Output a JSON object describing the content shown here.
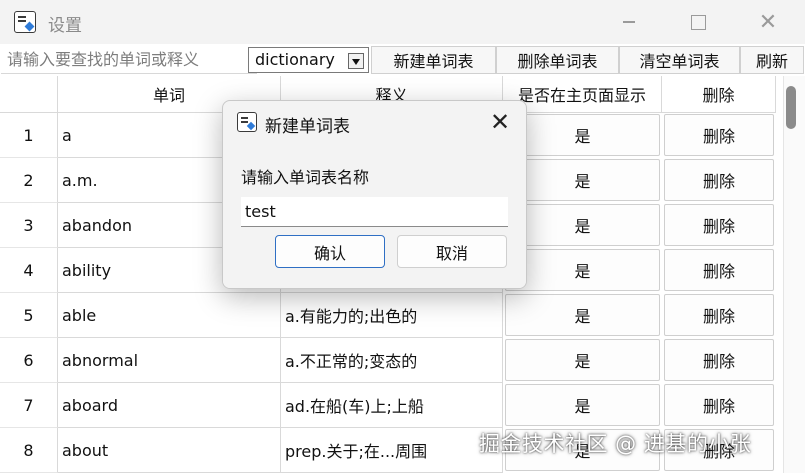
{
  "window": {
    "title": "设置",
    "icon": "notepad-icon",
    "controls": [
      "minimize-icon",
      "maximize-icon",
      "close-icon"
    ]
  },
  "toolbar": {
    "search_placeholder": "请输入要查找的单词或释义",
    "dictionary_selected": "dictionary",
    "new_table_label": "新建单词表",
    "delete_table_label": "删除单词表",
    "clear_table_label": "清空单词表",
    "refresh_label": "刷新"
  },
  "table": {
    "headers": [
      "单词",
      "释义",
      "是否在主页面显示",
      "删除"
    ],
    "rows": [
      {
        "num": "1",
        "word": "a",
        "meaning": "",
        "show": "是",
        "delete": "删除"
      },
      {
        "num": "2",
        "word": "a.m.",
        "meaning": "",
        "show": "是",
        "delete": "删除"
      },
      {
        "num": "3",
        "word": "abandon",
        "meaning": "",
        "show": "是",
        "delete": "删除"
      },
      {
        "num": "4",
        "word": "ability",
        "meaning": "",
        "show": "是",
        "delete": "删除"
      },
      {
        "num": "5",
        "word": "able",
        "meaning": "a.有能力的;出色的",
        "show": "是",
        "delete": "删除"
      },
      {
        "num": "6",
        "word": "abnormal",
        "meaning": "a.不正常的;变态的",
        "show": "是",
        "delete": "删除"
      },
      {
        "num": "7",
        "word": "aboard",
        "meaning": "ad.在船(车)上;上船",
        "show": "是",
        "delete": "删除"
      },
      {
        "num": "8",
        "word": "about",
        "meaning": "prep.关于;在...周围",
        "show": "是",
        "delete": "删除"
      }
    ]
  },
  "dialog": {
    "title": "新建单词表",
    "prompt": "请输入单词表名称",
    "input_value": "test",
    "ok_label": "确认",
    "cancel_label": "取消"
  },
  "watermark": "掘金技术社区 @ 进基的小张",
  "colors": {
    "titlebar_bg": "#f3f3f3",
    "dialog_ok_border": "#2f6fc4",
    "accent_icon": "#2f7bd8",
    "scrollbar_thumb": "#8b8b8b"
  }
}
